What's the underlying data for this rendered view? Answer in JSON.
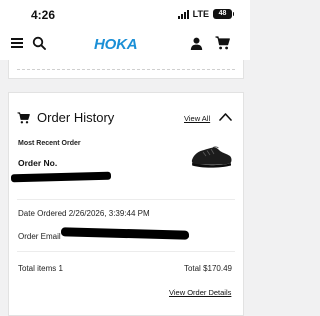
{
  "status_bar": {
    "time": "4:26",
    "network": "LTE",
    "battery": "48"
  },
  "header": {
    "logo": "HOKA",
    "brand_color": "#1a8fd6"
  },
  "order_history": {
    "title": "Order History",
    "view_all_label": "View All",
    "section_label": "Most Recent Order",
    "order_no_label": "Order No.",
    "date_ordered_label": "Date Ordered",
    "date_ordered_value": "2/26/2026, 3:39:44 PM",
    "order_email_label": "Order Email",
    "total_items_label": "Total items",
    "total_items_value": "1",
    "total_label": "Total",
    "total_value": "$170.49",
    "view_details_label": "View Order Details"
  }
}
